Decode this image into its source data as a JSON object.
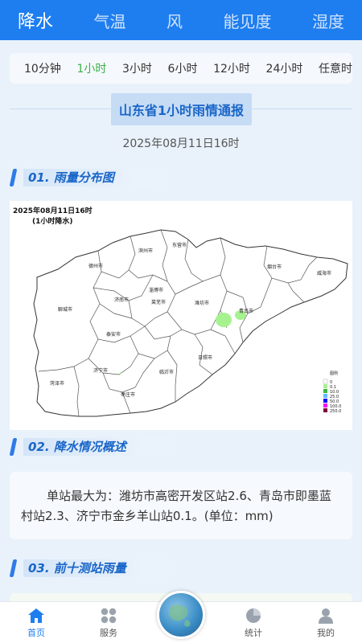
{
  "top_tabs": [
    {
      "label": "降水",
      "active": true
    },
    {
      "label": "气温",
      "active": false
    },
    {
      "label": "风",
      "active": false
    },
    {
      "label": "能见度",
      "active": false
    },
    {
      "label": "湿度",
      "active": false
    }
  ],
  "time_ranges": [
    {
      "label": "10分钟",
      "active": false
    },
    {
      "label": "1小时",
      "active": true
    },
    {
      "label": "3小时",
      "active": false
    },
    {
      "label": "6小时",
      "active": false
    },
    {
      "label": "12小时",
      "active": false
    },
    {
      "label": "24小时",
      "active": false
    },
    {
      "label": "任意时",
      "active": false
    }
  ],
  "report": {
    "title": "山东省1小时雨情通报",
    "time": "2025年08月11日16时"
  },
  "sections": {
    "s1": "01. 雨量分布图",
    "s2": "02. 降水情况概述",
    "s3": "03. 前十测站雨量"
  },
  "map": {
    "time_label": "2025年08月11日16时",
    "type_label": "(1小时降水)",
    "cities": [
      "滨州市",
      "东营市",
      "德州市",
      "淄博市",
      "潍坊市",
      "烟台市",
      "威海市",
      "聊城市",
      "济南市",
      "青岛市",
      "泰安市",
      "莱芜市",
      "日照市",
      "临沂市",
      "济宁市",
      "菏泽市",
      "枣庄市"
    ],
    "legend_title": "图例",
    "legend": [
      {
        "label": "0",
        "color": "#ffffff"
      },
      {
        "label": "0.1",
        "color": "#a6f28f"
      },
      {
        "label": "10.0",
        "color": "#3dba3d"
      },
      {
        "label": "25.0",
        "color": "#61b8ff"
      },
      {
        "label": "50.0",
        "color": "#0000ff"
      },
      {
        "label": "100.0",
        "color": "#fa00fa"
      },
      {
        "label": "250.0",
        "color": "#800040"
      }
    ]
  },
  "summary": "单站最大为：潍坊市高密开发区站2.6、青岛市即墨蓝村站2.3、济宁市金乡羊山站0.1。(单位：mm)",
  "nav": [
    {
      "label": "首页",
      "icon": "home-icon",
      "active": true
    },
    {
      "label": "服务",
      "icon": "grid-icon",
      "active": false
    },
    {
      "label": "统计",
      "icon": "pie-chart-icon",
      "active": false
    },
    {
      "label": "我的",
      "icon": "user-icon",
      "active": false
    }
  ],
  "colors": {
    "primary": "#1e7ef0",
    "active_option": "#3bb14a",
    "rain_light": "#a6f28f"
  }
}
